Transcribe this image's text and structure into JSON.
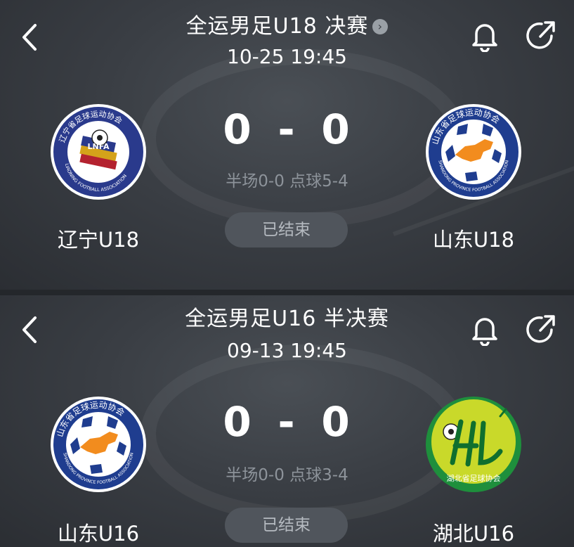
{
  "matches": [
    {
      "title": "全运男足U18 决赛",
      "datetime": "10-25 19:45",
      "home_name": "辽宁U18",
      "away_name": "山东U18",
      "home_score": "0",
      "away_score": "0",
      "separator": "-",
      "detail": "半场0-0 点球5-4",
      "status": "已结束",
      "home_logo_text": "辽宁省足球运动协会",
      "home_logo_text_en": "LIAONING FOOTBALL ASSOCIATION",
      "home_logo_abbr": "LNFA",
      "away_logo_text": "山东省足球运动协会",
      "away_logo_text_en": "SHANDONG PROVINCE FOOTBALL ASSOCIATION"
    },
    {
      "title": "全运男足U16 半决赛",
      "datetime": "09-13 19:45",
      "home_name": "山东U16",
      "away_name": "湖北U16",
      "home_score": "0",
      "away_score": "0",
      "separator": "-",
      "detail": "半场0-0 点球3-4",
      "status": "已结束",
      "home_logo_text": "山东省足球运动协会",
      "home_logo_text_en": "SHANDONG PROVINCE FOOTBALL ASSOCIATION",
      "away_logo_text": "湖北省足球协会"
    }
  ],
  "icons": {
    "back": "chevron-left-icon",
    "bell": "bell-icon",
    "share": "share-icon",
    "title_arrow": "chevron-right-circle-icon"
  },
  "colors": {
    "background": "#3a3e44",
    "status_pill": "#50555c",
    "detail_text": "#8d939a",
    "shandong_logo": "#1f3d8f",
    "hubei_logo": "#1e8f3c",
    "liaoning_logo": "#2a3a8c"
  }
}
